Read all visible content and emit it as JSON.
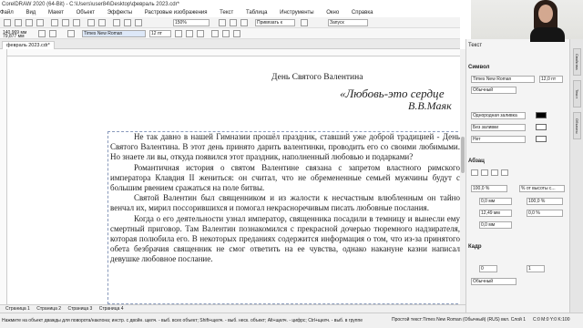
{
  "app": {
    "title": "CorelDRAW 2020 (64-Bit) - C:\\Users\\user84\\Desktop\\февраль 2023.cdr*"
  },
  "menu": [
    "Файл",
    "Вид",
    "Макет",
    "Объект",
    "Эффекты",
    "Растровые изображения",
    "Текст",
    "Таблица",
    "Инструменты",
    "Окно",
    "Справка"
  ],
  "propbar": {
    "x": "140,969 мм",
    "y": "79,877 мм",
    "font": "Times New Roman",
    "size": "12 пт",
    "zoom": "150%",
    "snap": "Привязать к",
    "launch": "Запуск"
  },
  "doc_tab": "февраль 2023.cdr*",
  "canvas": {
    "heading": "День Святого Валентина",
    "quote": "«Любовь-это сердце",
    "author": "В.В.Маяк",
    "paragraphs": [
      "Не так давно в нашей Гимназии прошёл праздник, ставший уже доброй традицией - День Святого Валентина. В этот день принято дарить валентинки, проводить его со своими любимыми. Но знаете ли вы, откуда появился этот праздник, наполненный любовью и подарками?",
      "Романтичная история о святом Валентине связана с запретом властного римского императора Клавдия II жениться: он считал, что не обремененные семьей мужчины будут с большим рвением сражаться на поле битвы.",
      "Святой Валентин был священником и из жалости к несчастным влюбленным он тайно венчал их, мирил поссорившихся и помогал некрасноречивым писать любовные послания.",
      "Когда о его деятельности узнал император, священника посадили в темницу и вынесли ему смертный приговор. Там Валентин познакомился с прекрасной дочерью тюремного надзирателя, которая полюбила его. В некоторых преданиях содержится информация о том, что из-за принятого обета безбрачия священник не смог ответить на ее чувства, однако накануне казни написал девушке любовное послание."
    ]
  },
  "page_tabs": [
    "Страница 1",
    "Страница 2",
    "Страница 3",
    "Страница 4"
  ],
  "status": {
    "hint": "Нажмите на объект дважды для поворота/наклона; инстр. с двойн. щелч. - выб. всех объект; Shift+щелч. - выб. неск. объект; Alt+щелч. - цифрс; Ctrl+щелч. - выб. в группе",
    "object": "Простой текст:Times New Roman (Обычный) (RUS) вкл. Слой 1",
    "coords": "C:0 M:0 Y:0 K:100"
  },
  "panel": {
    "title": "Текст",
    "char_section": "Символ",
    "font": "Times New Roman",
    "size": "12,0 пт",
    "style": "Обычный",
    "fill1": "Однородная заливка",
    "fill2": "Без заливки",
    "outline": "Нет",
    "para_section": "Абзац",
    "spacing_pct": "100,0 %",
    "spacing_of": "% от высоты с...",
    "indent1": "0,0 мм",
    "indent2": "12,49 мм",
    "indent3": "0,0 мм",
    "pct2": "100,0 %",
    "pct3": "0,0 %",
    "frame_section": "Кадр",
    "frame1": "0",
    "frame2": "1",
    "frame_style": "Обычный"
  },
  "side_tabs": [
    "Свойства",
    "Текст",
    "Объекты"
  ],
  "colors": {
    "accent": "#2f6fd6"
  }
}
